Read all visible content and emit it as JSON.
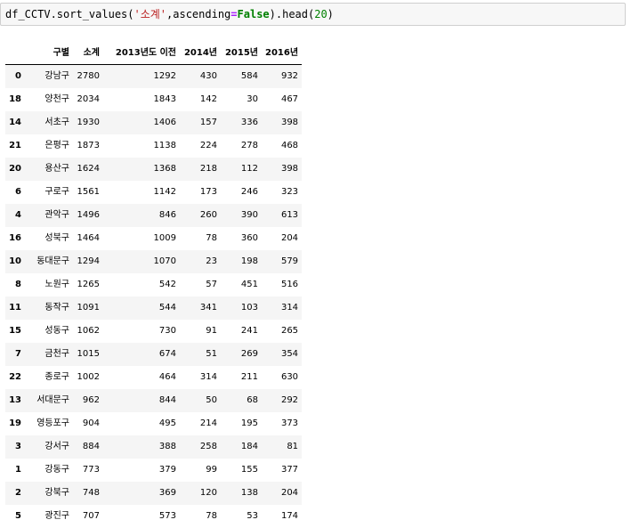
{
  "code": {
    "prefix": "df_CCTV.sort_values(",
    "string_arg": "'소계'",
    "comma": ",ascending",
    "equals": "=",
    "keyword": "False",
    "suffix": ").head(",
    "number": "20",
    "close": ")"
  },
  "table": {
    "columns": [
      "",
      "구별",
      "소계",
      "2013년도 이전",
      "2014년",
      "2015년",
      "2016년"
    ],
    "rows": [
      {
        "index": "0",
        "cells": [
          "강남구",
          "2780",
          "1292",
          "430",
          "584",
          "932"
        ]
      },
      {
        "index": "18",
        "cells": [
          "양천구",
          "2034",
          "1843",
          "142",
          "30",
          "467"
        ]
      },
      {
        "index": "14",
        "cells": [
          "서초구",
          "1930",
          "1406",
          "157",
          "336",
          "398"
        ]
      },
      {
        "index": "21",
        "cells": [
          "은평구",
          "1873",
          "1138",
          "224",
          "278",
          "468"
        ]
      },
      {
        "index": "20",
        "cells": [
          "용산구",
          "1624",
          "1368",
          "218",
          "112",
          "398"
        ]
      },
      {
        "index": "6",
        "cells": [
          "구로구",
          "1561",
          "1142",
          "173",
          "246",
          "323"
        ]
      },
      {
        "index": "4",
        "cells": [
          "관악구",
          "1496",
          "846",
          "260",
          "390",
          "613"
        ]
      },
      {
        "index": "16",
        "cells": [
          "성북구",
          "1464",
          "1009",
          "78",
          "360",
          "204"
        ]
      },
      {
        "index": "10",
        "cells": [
          "동대문구",
          "1294",
          "1070",
          "23",
          "198",
          "579"
        ]
      },
      {
        "index": "8",
        "cells": [
          "노원구",
          "1265",
          "542",
          "57",
          "451",
          "516"
        ]
      },
      {
        "index": "11",
        "cells": [
          "동작구",
          "1091",
          "544",
          "341",
          "103",
          "314"
        ]
      },
      {
        "index": "15",
        "cells": [
          "성동구",
          "1062",
          "730",
          "91",
          "241",
          "265"
        ]
      },
      {
        "index": "7",
        "cells": [
          "금천구",
          "1015",
          "674",
          "51",
          "269",
          "354"
        ]
      },
      {
        "index": "22",
        "cells": [
          "종로구",
          "1002",
          "464",
          "314",
          "211",
          "630"
        ]
      },
      {
        "index": "13",
        "cells": [
          "서대문구",
          "962",
          "844",
          "50",
          "68",
          "292"
        ]
      },
      {
        "index": "19",
        "cells": [
          "영등포구",
          "904",
          "495",
          "214",
          "195",
          "373"
        ]
      },
      {
        "index": "3",
        "cells": [
          "강서구",
          "884",
          "388",
          "258",
          "184",
          "81"
        ]
      },
      {
        "index": "1",
        "cells": [
          "강동구",
          "773",
          "379",
          "99",
          "155",
          "377"
        ]
      },
      {
        "index": "2",
        "cells": [
          "강북구",
          "748",
          "369",
          "120",
          "138",
          "204"
        ]
      },
      {
        "index": "5",
        "cells": [
          "광진구",
          "707",
          "573",
          "78",
          "53",
          "174"
        ]
      }
    ]
  }
}
